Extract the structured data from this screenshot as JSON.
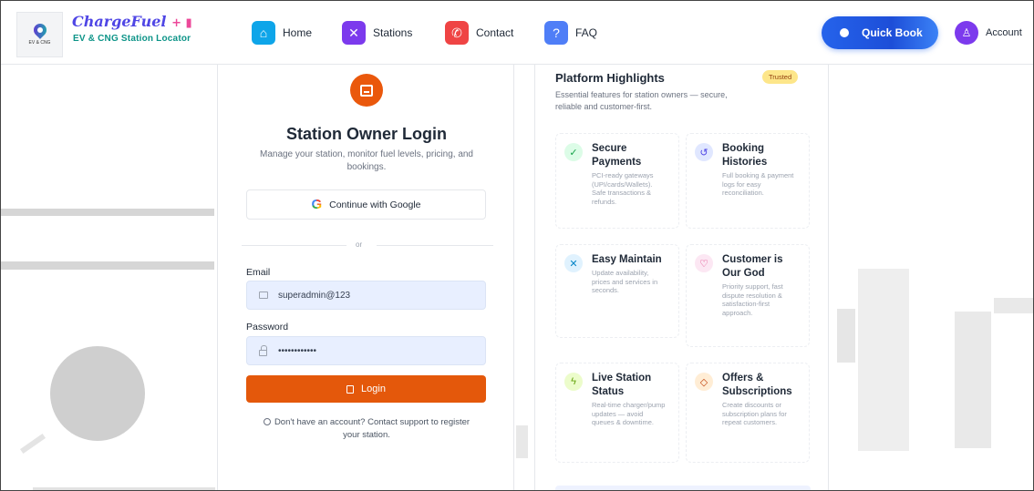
{
  "header": {
    "brand_title": "ChargeFuel",
    "brand_subtitle": "EV & CNG Station Locator",
    "logo_caption": "EV & CNG",
    "nav": [
      {
        "label": "Home",
        "icon": "home-icon"
      },
      {
        "label": "Stations",
        "icon": "tools-icon"
      },
      {
        "label": "Contact",
        "icon": "phone-icon"
      },
      {
        "label": "FAQ",
        "icon": "question-icon"
      }
    ],
    "quick_book_label": "Quick Book",
    "account_label": "Account"
  },
  "login": {
    "title": "Station Owner Login",
    "description": "Manage your station, monitor fuel levels, pricing, and bookings.",
    "google_label": "Continue with Google",
    "or_text": "or",
    "email_label": "Email",
    "email_value": "superadmin@123",
    "password_label": "Password",
    "password_value": "••••••••••••",
    "login_button": "Login",
    "support_note": "Don't have an account? Contact support to register your station."
  },
  "highlights": {
    "title": "Platform Highlights",
    "badge": "Trusted",
    "subtitle": "Essential features for station owners — secure, reliable and customer-first.",
    "features": [
      {
        "title": "Secure Payments",
        "desc": "PCI-ready gateways (UPI/cards/Wallets). Safe transactions & refunds.",
        "icon": "shield-check-icon"
      },
      {
        "title": "Booking Histories",
        "desc": "Full booking & payment logs for easy reconciliation.",
        "icon": "history-icon"
      },
      {
        "title": "Easy Maintain",
        "desc": "Update availability, prices and services in seconds.",
        "icon": "tools-icon"
      },
      {
        "title": "Customer is Our God",
        "desc": "Priority support, fast dispute resolution & satisfaction-first approach.",
        "icon": "heart-icon"
      },
      {
        "title": "Live Station Status",
        "desc": "Real-time charger/pump updates — avoid queues & downtime.",
        "icon": "lightning-icon"
      },
      {
        "title": "Offers & Subscriptions",
        "desc": "Create discounts or subscription plans for repeat customers.",
        "icon": "tag-icon"
      }
    ]
  },
  "colors": {
    "accent_orange": "#e4580b",
    "quick_book_blue": "#2563eb",
    "brand_indigo": "#4f46e5",
    "brand_teal": "#0d9488"
  }
}
